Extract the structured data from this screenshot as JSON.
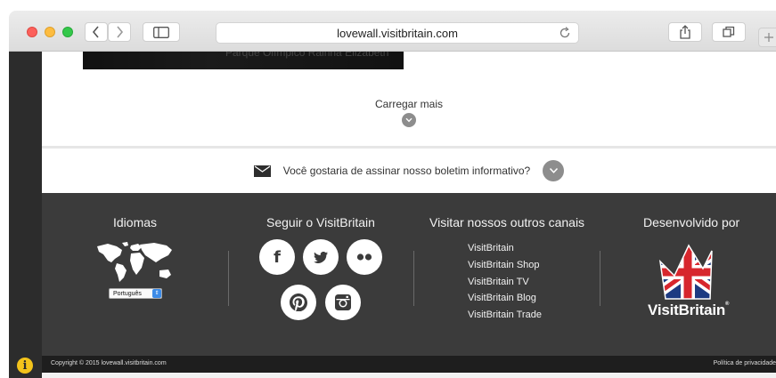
{
  "browser": {
    "url": "lovewall.visitbritain.com"
  },
  "page": {
    "hero_caption": "Parque Olímpico Rainha Elizabeth",
    "load_more_label": "Carregar mais",
    "newsletter_text": "Você gostaria de assinar nosso boletim informativo?"
  },
  "footer": {
    "languages": {
      "title": "Idiomas",
      "selected": "Português"
    },
    "social": {
      "title": "Seguir o VisitBritain",
      "icons": [
        "facebook-icon",
        "twitter-icon",
        "flickr-icon",
        "pinterest-icon",
        "instagram-icon"
      ]
    },
    "channels": {
      "title": "Visitar nossos outros canais",
      "links": [
        "VisitBritain",
        "VisitBritain Shop",
        "VisitBritain TV",
        "VisitBritain Blog",
        "VisitBritain Trade"
      ]
    },
    "developed": {
      "title": "Desenvolvido por",
      "logo_text": "VisitBritain",
      "logo_mark": "®"
    },
    "copyright": "Copyright © 2015 lovewall.visitbritain.com",
    "privacy": "Política de privacidade"
  },
  "colors": {
    "footer_bg": "#3b3b3b",
    "copy_bg": "#1e1e1e",
    "chevron_bg": "#8d8d8d",
    "info_icon": "#f3c31b",
    "union_red": "#d7262d",
    "union_blue": "#1d3b82"
  }
}
